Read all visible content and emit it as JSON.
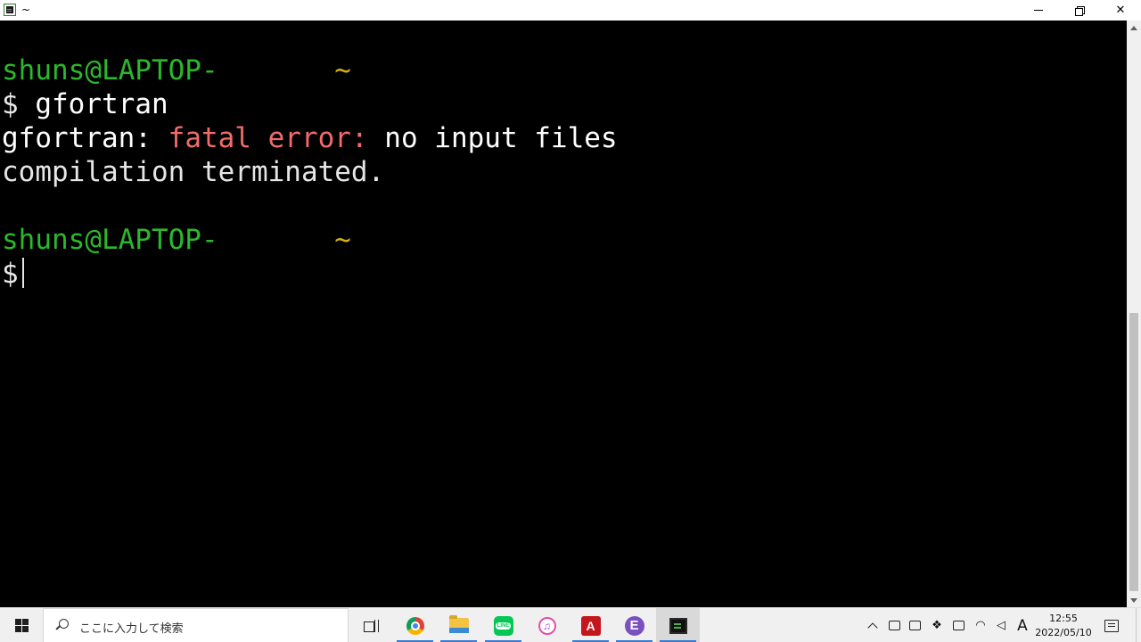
{
  "window": {
    "title": "~",
    "icon": "mintty-terminal-icon"
  },
  "terminal": {
    "lines": [
      {
        "user_host": "shuns@LAPTOP-",
        "path": "~"
      },
      {
        "prompt": "$",
        "command": "gfortran"
      },
      {
        "prog": "gfortran:",
        "error_label": "fatal error:",
        "message": "no input files"
      },
      {
        "text": "compilation terminated."
      },
      {
        "user_host": "shuns@LAPTOP-",
        "path": "~"
      },
      {
        "prompt": "$"
      }
    ]
  },
  "taskbar": {
    "search_placeholder": "ここに入力して検索",
    "apps": [
      "task-view",
      "chrome",
      "file-explorer",
      "line",
      "itunes",
      "acrobat",
      "emacs",
      "mintty"
    ],
    "tray": {
      "ime_mode": "A",
      "time": "12:55",
      "date": "2022/05/10"
    }
  },
  "colors": {
    "prompt_green": "#2bb82b",
    "path_yellow": "#d4b012",
    "error_red": "#f26b6b",
    "text": "#e6e6e6",
    "accent_underline": "#3d7ad0"
  }
}
